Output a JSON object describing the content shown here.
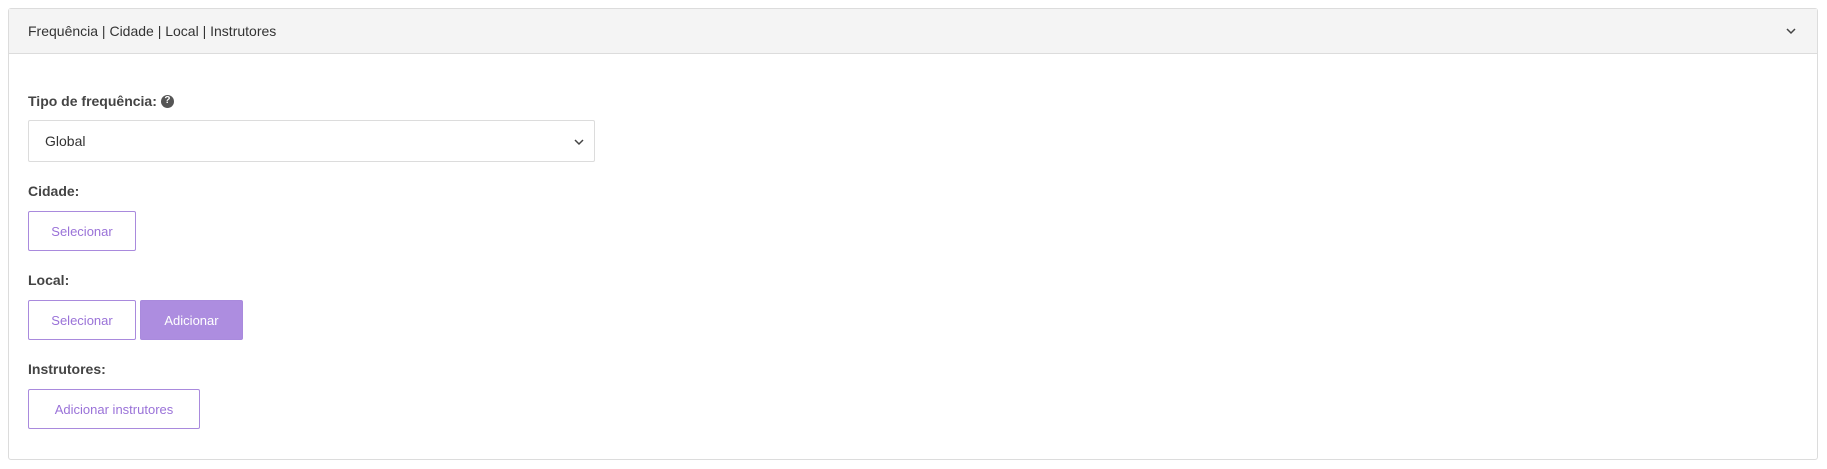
{
  "panel": {
    "title": "Frequência | Cidade | Local | Instrutores",
    "toggle_icon": "chevron-down-icon"
  },
  "frequency": {
    "label": "Tipo de frequência:",
    "help_icon": "question-circle-icon",
    "help_glyph": "?",
    "selected_value": "Global",
    "dropdown_icon": "chevron-down-icon"
  },
  "city": {
    "label": "Cidade:",
    "select_label": "Selecionar"
  },
  "location": {
    "label": "Local:",
    "select_label": "Selecionar",
    "add_label": "Adicionar"
  },
  "instructors": {
    "label": "Instrutores:",
    "add_label": "Adicionar instrutores"
  },
  "colors": {
    "accent": "#ad8de0",
    "accent_text": "#9a72d8",
    "header_bg": "#f4f4f4",
    "border": "#dcdcdc"
  }
}
